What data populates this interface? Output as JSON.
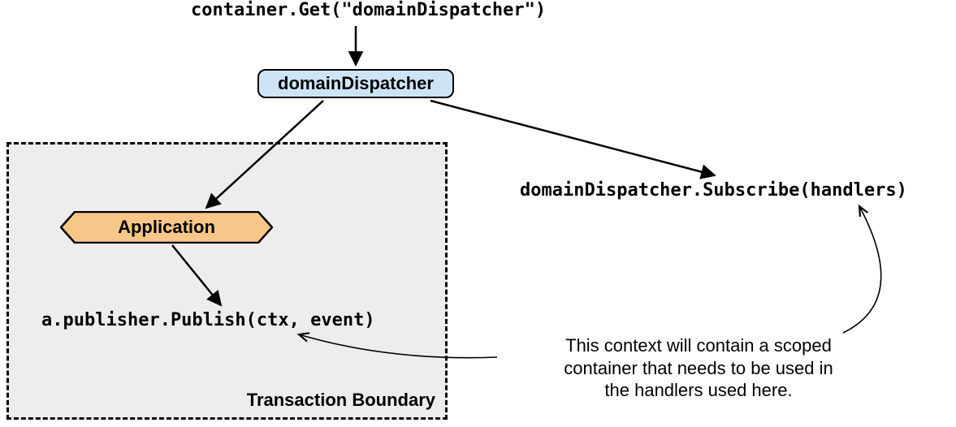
{
  "nodes": {
    "container_get": "container.Get(\"domainDispatcher\")",
    "dispatcher": "domainDispatcher",
    "application": "Application",
    "publish_call": "a.publisher.Publish(ctx, event)",
    "subscribe_call": "domainDispatcher.Subscribe(handlers)",
    "tx_boundary_label": "Transaction Boundary"
  },
  "annotation": {
    "line1": "This context will contain a scoped",
    "line2": "container that needs to be used in",
    "line3": "the handlers used here."
  },
  "colors": {
    "dispatcher_fill": "#cde4f7",
    "application_fill": "#f7c789",
    "tx_fill": "#ededed",
    "stroke": "#000000"
  }
}
